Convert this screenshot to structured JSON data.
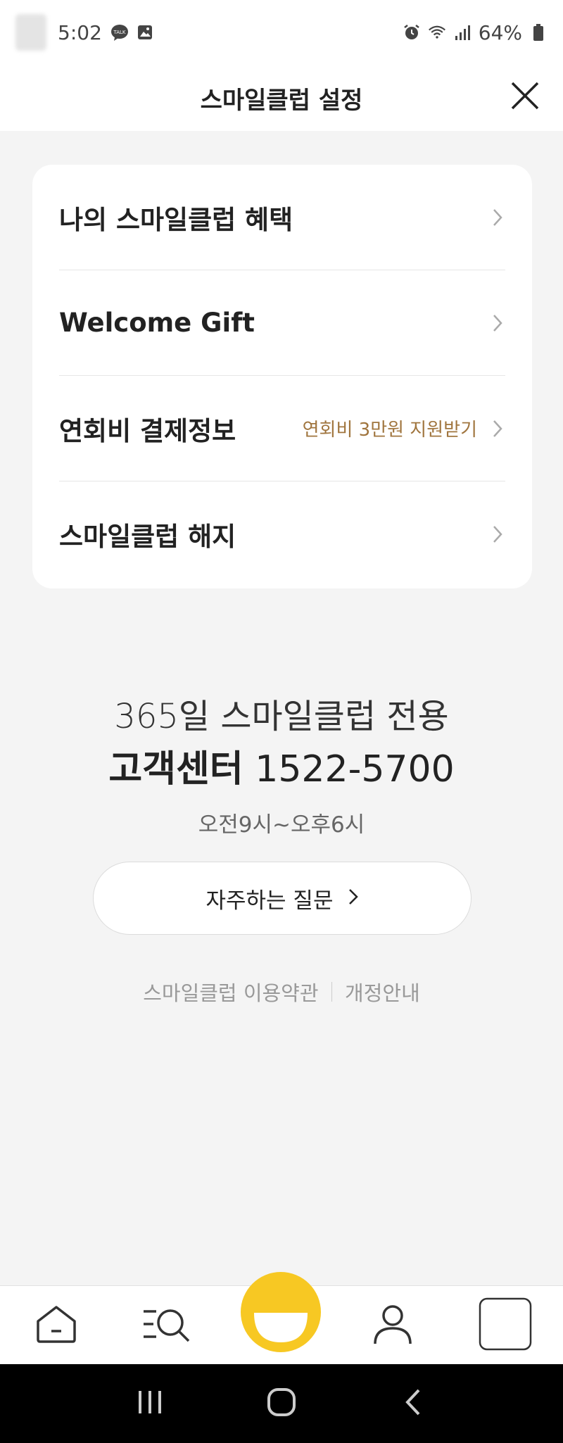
{
  "status_bar": {
    "time": "5:02",
    "battery": "64%",
    "icons": [
      "talk-icon",
      "gallery-icon",
      "alarm-icon",
      "wifi-icon",
      "signal-icon",
      "battery-icon"
    ]
  },
  "header": {
    "title": "스마일클럽 설정",
    "close_icon": "close-icon"
  },
  "menu": {
    "items": [
      {
        "label": "나의 스마일클럽 혜택",
        "sub": ""
      },
      {
        "label": "Welcome Gift",
        "sub": ""
      },
      {
        "label": "연회비 결제정보",
        "sub": "연회비 3만원 지원받기"
      },
      {
        "label": "스마일클럽 해지",
        "sub": ""
      }
    ]
  },
  "customer_center": {
    "headline": "365일 스마일클럽 전용",
    "label": "고객센터",
    "phone": "1522-5700",
    "hours": "오전9시~오후6시",
    "faq_label": "자주하는 질문"
  },
  "links": {
    "terms": "스마일클럽 이용약관",
    "notice": "개정안내"
  },
  "bottom_nav": {
    "items": [
      "home-icon",
      "search-menu-icon",
      "smile-icon",
      "profile-icon",
      "square-icon"
    ],
    "accent": "#f7c823"
  },
  "colors": {
    "background": "#f4f4f4",
    "accent_text": "#a0753e"
  }
}
